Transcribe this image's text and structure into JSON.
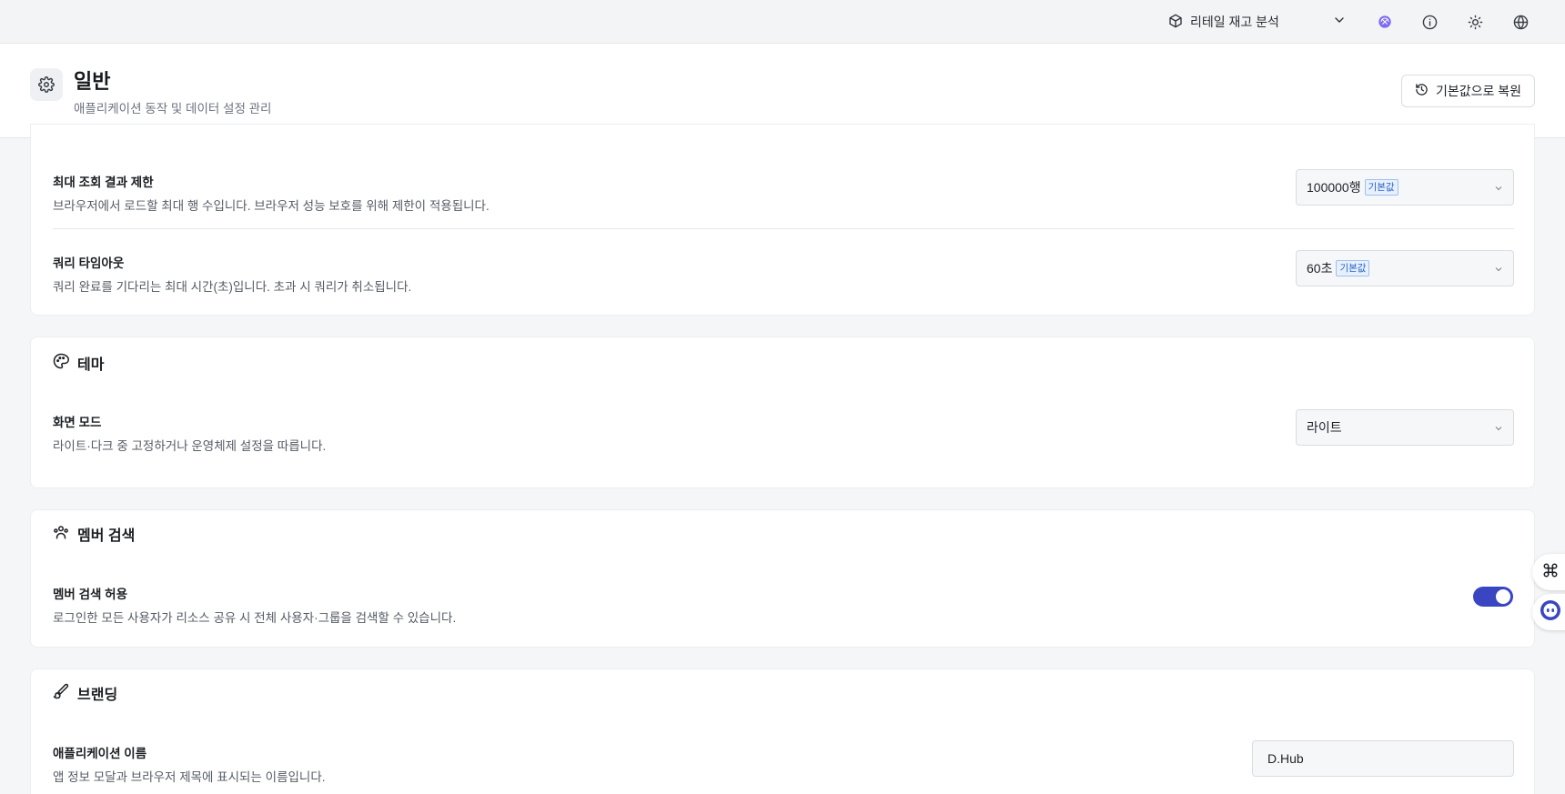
{
  "topbar": {
    "project_name": "리테일 재고 분석",
    "icons": [
      "cube-icon",
      "chevron-down-icon",
      "ai-logo-icon",
      "info-icon",
      "sun-icon",
      "globe-icon"
    ]
  },
  "header": {
    "title": "일반",
    "subtitle": "애플리케이션 동작 및 데이터 설정 관리",
    "reset_label": "기본값으로 복원"
  },
  "query": {
    "max_rows": {
      "label": "최대 조회 결과 제한",
      "desc": "브라우저에서 로드할 최대 행 수입니다. 브라우저 성능 보호를 위해 제한이 적용됩니다.",
      "value": "100000행",
      "badge": "기본값"
    },
    "timeout": {
      "label": "쿼리 타임아웃",
      "desc": "쿼리 완료를 기다리는 최대 시간(초)입니다. 초과 시 쿼리가 취소됩니다.",
      "value": "60초",
      "badge": "기본값"
    }
  },
  "theme": {
    "title": "테마",
    "mode_label": "화면 모드",
    "mode_desc": "라이트·다크 중 고정하거나 운영체제 설정을 따릅니다.",
    "mode_value": "라이트"
  },
  "member_search": {
    "title": "멤버 검색",
    "label": "멤버 검색 허용",
    "desc": "로그인한 모든 사용자가 리소스 공유 시 전체 사용자·그룹을 검색할 수 있습니다.",
    "enabled": true
  },
  "branding": {
    "title": "브랜딩",
    "app_name_label": "애플리케이션 이름",
    "app_name_desc": "앱 정보 모달과 브라우저 제목에 표시되는 이름입니다.",
    "app_name_value": "D.Hub"
  },
  "colors": {
    "accent": "#3a46c1",
    "badge_text": "#2563c9",
    "badge_bg": "#e7f0fc"
  }
}
